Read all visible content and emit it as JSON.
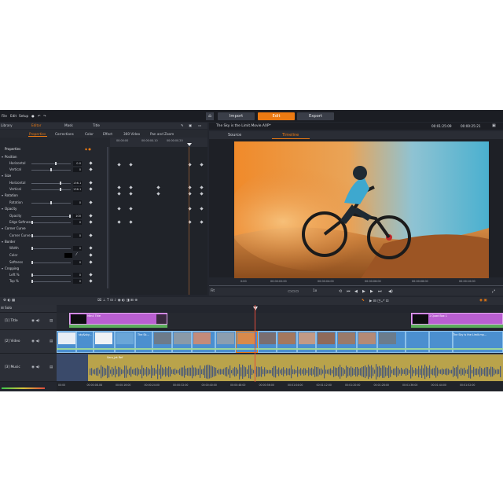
{
  "menu": [
    "File",
    "Edit",
    "Setup"
  ],
  "modes": [
    "Import",
    "Edit",
    "Export"
  ],
  "active_mode": "Edit",
  "left_tabs": [
    "Library",
    "Editor",
    "Mask",
    "Title"
  ],
  "editor_tabs": [
    "Properties",
    "Corrections",
    "Color",
    "Effect",
    "360 Video",
    "Pan and Zoom"
  ],
  "properties_header": "Properties",
  "properties": [
    {
      "label": "Position",
      "group": true
    },
    {
      "label": "Horizontal",
      "value": "0.0",
      "knob": 0.62
    },
    {
      "label": "Vertical",
      "value": "0",
      "knob": 0.5
    },
    {
      "label": "Size",
      "group": true
    },
    {
      "label": "Horizontal",
      "value": "136.1",
      "knob": 0.75
    },
    {
      "label": "Vertical",
      "value": "136.1",
      "knob": 0.75
    },
    {
      "label": "Rotation",
      "group": true
    },
    {
      "label": "Rotation",
      "value": "0",
      "knob": 0.5
    },
    {
      "label": "Opacity",
      "group": true
    },
    {
      "label": "Opacity",
      "value": "100",
      "knob": 1.0
    },
    {
      "label": "Edge Softness",
      "value": "0",
      "knob": 0.0
    },
    {
      "label": "Corner Curve",
      "group": true
    },
    {
      "label": "Corner Curve",
      "value": "0",
      "knob": 0.0
    },
    {
      "label": "Border",
      "group": true
    },
    {
      "label": "Width",
      "value": "0",
      "knob": 0.0
    },
    {
      "label": "Color",
      "value": "",
      "knob": null
    },
    {
      "label": "Softness",
      "value": "0",
      "knob": 0.0
    },
    {
      "label": "Cropping",
      "group": true
    },
    {
      "label": "Left %",
      "value": "0",
      "knob": 0.0
    },
    {
      "label": "Top %",
      "value": "0",
      "knob": 0.0
    }
  ],
  "keyframe_ruler": [
    "00:00:00",
    "00:00:00.10",
    "00:00:00.20"
  ],
  "viewer": {
    "title": "The Sky is the Limit.Movie.AXP*",
    "timecode_left": "00:01:25:09",
    "timecode_right": "00:00:25:21",
    "tabs": [
      "Source",
      "Timeline"
    ],
    "active_tab": "Timeline",
    "ruler": [
      "0:00",
      "00:00:02:00",
      "00:00:04:00",
      "00:00:06:00",
      "00:00:08:00",
      "00:00:10:00"
    ],
    "zoom": "Fit",
    "speed": "1x"
  },
  "tracks": [
    {
      "name": "Solo",
      "kind": "solo"
    },
    {
      "name": "[1] Title",
      "kind": "title"
    },
    {
      "name": "[2] Video",
      "kind": "video"
    },
    {
      "name": "[3] Music",
      "kind": "music"
    }
  ],
  "clips": {
    "title_left": "Mtn4 Title",
    "title_right": "1 Quad Box 1",
    "video_1": "sky&sky...",
    "video_2": "The Sk...",
    "video_3": "The Sky is the Limit.mp...",
    "music": "Sera_jet Ref"
  },
  "bottom_ruler": [
    "00:00",
    "00:00:08.08",
    "00:00:16:00",
    "00:00:24:00",
    "00:00:32:00",
    "00:00:40:00",
    "00:00:48:00",
    "00:00:56:00",
    "00:01:04:00",
    "00:01:12:00",
    "00:01:20:00",
    "00:01:28:00",
    "00:01:36:00",
    "00:01:44:00",
    "00:01:52:00"
  ],
  "colors": {
    "accent": "#ec7a12",
    "title_clip": "#b95fd1",
    "video_clip": "#4b8fcf",
    "music_clip": "#b9a34b",
    "playhead": "#e14b3c"
  }
}
